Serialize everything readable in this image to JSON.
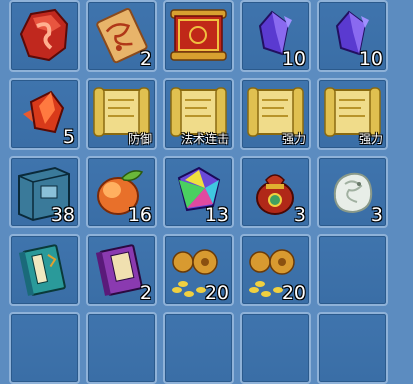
{
  "inventory": {
    "slots": [
      {
        "name": "red-dragon-stone",
        "count": "",
        "tag": ""
      },
      {
        "name": "treasure-map-scroll",
        "count": "2",
        "tag": ""
      },
      {
        "name": "golden-scroll",
        "count": "",
        "tag": ""
      },
      {
        "name": "purple-crystal",
        "count": "10",
        "tag": ""
      },
      {
        "name": "purple-crystal",
        "count": "10",
        "tag": ""
      },
      {
        "name": "red-crystal",
        "count": "5",
        "tag": ""
      },
      {
        "name": "skill-book-scroll",
        "count": "",
        "tag": "防御"
      },
      {
        "name": "skill-book-scroll",
        "count": "",
        "tag": "法术连击"
      },
      {
        "name": "skill-book-scroll",
        "count": "",
        "tag": "强力"
      },
      {
        "name": "skill-book-scroll",
        "count": "",
        "tag": "强力"
      },
      {
        "name": "blue-book",
        "count": "38",
        "tag": ""
      },
      {
        "name": "peach",
        "count": "16",
        "tag": ""
      },
      {
        "name": "rainbow-gem",
        "count": "13",
        "tag": ""
      },
      {
        "name": "treasure-bag",
        "count": "3",
        "tag": ""
      },
      {
        "name": "jade-beast",
        "count": "3",
        "tag": ""
      },
      {
        "name": "green-book",
        "count": "",
        "tag": ""
      },
      {
        "name": "purple-book",
        "count": "2",
        "tag": ""
      },
      {
        "name": "gourd-coins",
        "count": "20",
        "tag": ""
      },
      {
        "name": "gourd-coins",
        "count": "20",
        "tag": ""
      },
      {
        "name": "empty-slot",
        "count": "",
        "tag": ""
      }
    ]
  }
}
